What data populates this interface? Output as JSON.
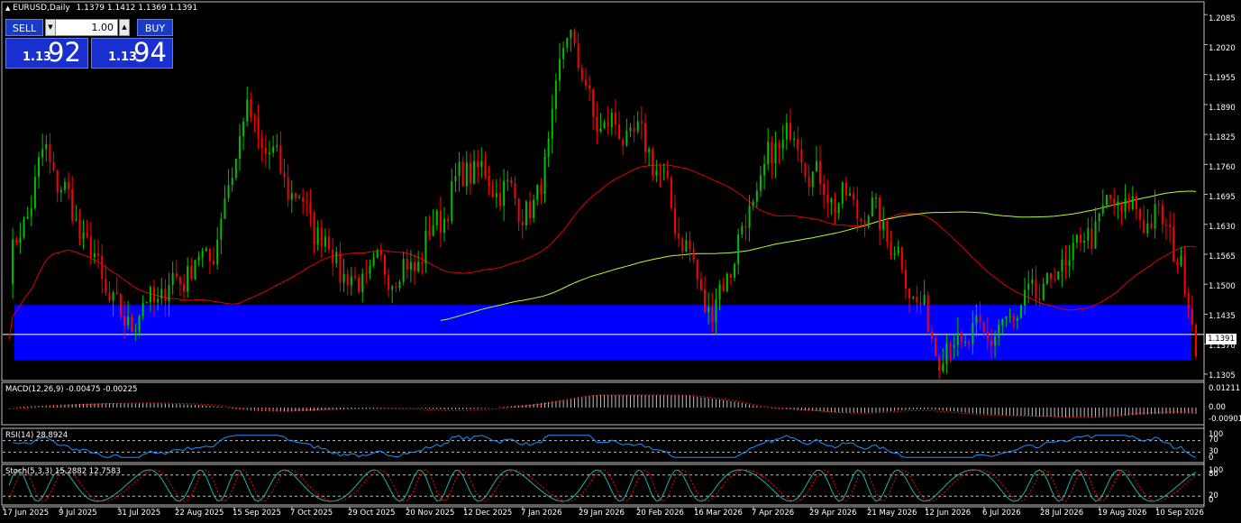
{
  "header": {
    "symbol": "EURUSD,Daily",
    "ohlc": "1.1379 1.1412 1.1369 1.1391",
    "arrow": "▲"
  },
  "trade_panel": {
    "sell_label": "SELL",
    "buy_label": "BUY",
    "lot_value": "1.00",
    "down_arrow": "▼",
    "up_arrow": "▲",
    "sell_prefix": "1.13",
    "sell_pips": "92",
    "buy_prefix": "1.13",
    "buy_pips": "94"
  },
  "price_axis": [
    "1.2085",
    "1.2020",
    "1.1955",
    "1.1890",
    "1.1825",
    "1.1760",
    "1.1695",
    "1.1630",
    "1.1565",
    "1.1500",
    "1.1435",
    "1.1370",
    "1.1305"
  ],
  "current_price": "1.1391",
  "date_axis": [
    "17 Jun 2025",
    "9 Jul 2025",
    "31 Jul 2025",
    "22 Aug 2025",
    "15 Sep 2025",
    "7 Oct 2025",
    "29 Oct 2025",
    "20 Nov 2025",
    "12 Dec 2025",
    "7 Jan 2026",
    "29 Jan 2026",
    "20 Feb 2026",
    "16 Mar 2026",
    "7 Apr 2026",
    "29 Apr 2026",
    "21 May 2026",
    "12 Jun 2026",
    "6 Jul 2026",
    "28 Jul 2026",
    "19 Aug 2026",
    "10 Sep 2026"
  ],
  "macd": {
    "label": "MACD(12,26,9) -0.00475 -0.00225",
    "axis": [
      "0.01211",
      "0.00",
      "-0.00901"
    ]
  },
  "rsi": {
    "label": "RSI(14) 28.8924",
    "axis": [
      "100",
      "70",
      "30",
      "0"
    ]
  },
  "stoch": {
    "label": "Stoch(5,3,3) 15.2882 12.7583",
    "axis": [
      "100",
      "80",
      "20",
      "0"
    ]
  },
  "colors": {
    "bull": "#00c000",
    "bear": "#ff0000",
    "zone": "#0000ff",
    "ma_fast": "#e00000",
    "ma_slow": "#adff2f",
    "rsi_line": "#1e90ff",
    "stoch_main": "#20b2aa",
    "stoch_signal": "#ff0000"
  },
  "chart_data": {
    "type": "candlestick",
    "symbol": "EURUSD",
    "timeframe": "Daily",
    "ylim": [
      1.1295,
      1.2105
    ],
    "key_points": [
      {
        "date": "17 Jun 2025",
        "price": 1.153
      },
      {
        "date": "1 Jul 2025",
        "price": 1.179
      },
      {
        "date": "31 Jul 2025",
        "price": 1.141
      },
      {
        "date": "5 Sep 2025",
        "price": 1.158
      },
      {
        "date": "16 Sep 2025",
        "price": 1.187
      },
      {
        "date": "29 Oct 2025",
        "price": 1.149
      },
      {
        "date": "4 Nov 2025",
        "price": 1.153
      },
      {
        "date": "20 Nov 2025",
        "price": 1.153
      },
      {
        "date": "12 Dec 2025",
        "price": 1.176
      },
      {
        "date": "7 Jan 2026",
        "price": 1.165
      },
      {
        "date": "20 Jan 2026",
        "price": 1.207
      },
      {
        "date": "29 Jan 2026",
        "price": 1.186
      },
      {
        "date": "20 Feb 2026",
        "price": 1.18
      },
      {
        "date": "16 Mar 2026",
        "price": 1.143
      },
      {
        "date": "7 Apr 2026",
        "price": 1.176
      },
      {
        "date": "15 Apr 2026",
        "price": 1.184
      },
      {
        "date": "29 Apr 2026",
        "price": 1.17
      },
      {
        "date": "21 May 2026",
        "price": 1.164
      },
      {
        "date": "12 Jun 2026",
        "price": 1.136
      },
      {
        "date": "6 Jul 2026",
        "price": 1.14
      },
      {
        "date": "28 Jul 2026",
        "price": 1.152
      },
      {
        "date": "19 Aug 2026",
        "price": 1.168
      },
      {
        "date": "10 Sep 2026",
        "price": 1.162
      },
      {
        "date": "20 Sep 2026",
        "price": 1.1391
      }
    ],
    "zone": {
      "low": 1.1335,
      "high": 1.1455
    },
    "current_price": 1.1391
  }
}
